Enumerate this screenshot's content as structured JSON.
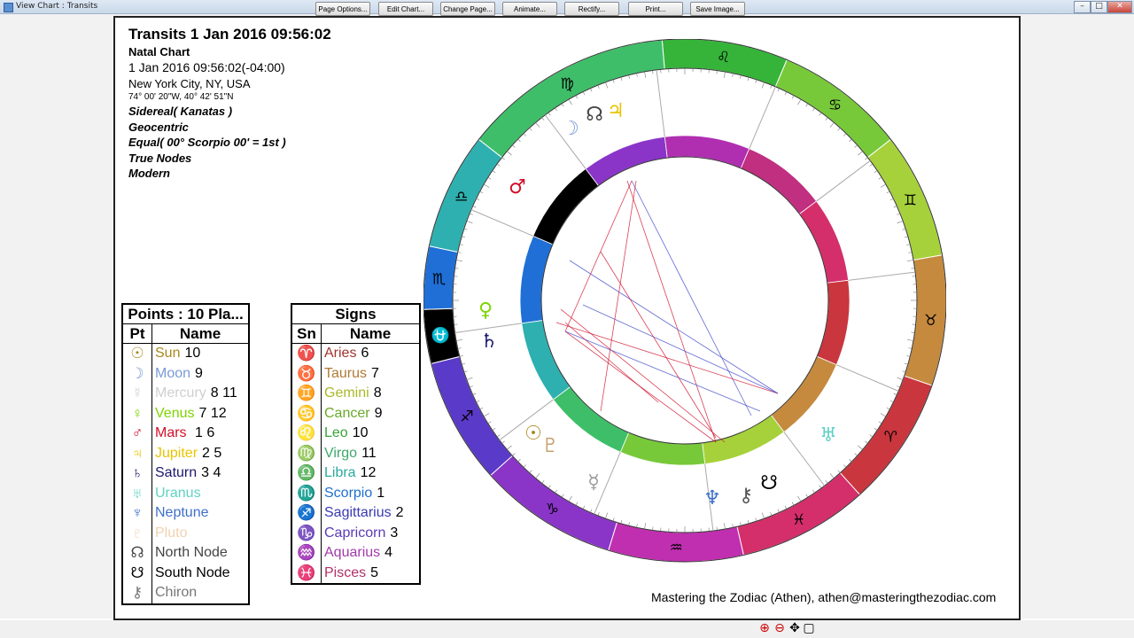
{
  "window": {
    "title": "View Chart : Transits",
    "minimize": "–",
    "maximize": "□",
    "close": "✕"
  },
  "header": {
    "title": "Transits 1 Jan 2016 09:56:02",
    "subtitle": "Natal Chart",
    "datetime": "1 Jan 2016 09:56:02(-04:00)",
    "location": "New York City, NY, USA",
    "coordinates": "74° 00' 20\"W, 40° 42' 51\"N",
    "zodiac": "Sidereal( Kanatas )",
    "centric": "Geocentric",
    "houses": "Equal( 00° Scorpio 00' = 1st )",
    "nodes": "True Nodes",
    "rulers": "Modern"
  },
  "points_table": {
    "title": "Points : 10 Pla...",
    "col_glyph": "Pt",
    "col_name": "Name",
    "rows": [
      {
        "glyph": "☉",
        "name": "Sun",
        "houses": "10",
        "color": "#a8891a"
      },
      {
        "glyph": "☽",
        "name": "Moon",
        "houses": "9",
        "color": "#7a9bd6"
      },
      {
        "glyph": "☿",
        "name": "Mercury",
        "houses": "8 11",
        "color": "#cfcfcf"
      },
      {
        "glyph": "♀",
        "name": "Venus",
        "houses": "7  12",
        "color": "#7fd400"
      },
      {
        "glyph": "♂",
        "name": "Mars",
        "houses": " 1 6",
        "color": "#d0102a"
      },
      {
        "glyph": "♃",
        "name": "Jupiter",
        "houses": "2 5",
        "color": "#e8c400"
      },
      {
        "glyph": "♄",
        "name": "Saturn",
        "houses": "3  4",
        "color": "#1a1a6e"
      },
      {
        "glyph": "♅",
        "name": "Uranus",
        "houses": "",
        "color": "#5fd1c4"
      },
      {
        "glyph": "♆",
        "name": "Neptune",
        "houses": "",
        "color": "#3f6fc9"
      },
      {
        "glyph": "♇",
        "name": "Pluto",
        "houses": "",
        "color": "#f0d2b0"
      },
      {
        "glyph": "☊",
        "name": "North Node",
        "houses": "",
        "color": "#444444"
      },
      {
        "glyph": "☋",
        "name": "South Node",
        "houses": "",
        "color": "#000000"
      },
      {
        "glyph": "⚷",
        "name": "Chiron",
        "houses": "",
        "color": "#777777"
      }
    ]
  },
  "signs_table": {
    "title": "Signs",
    "col_glyph": "Sn",
    "col_name": "Name",
    "rows": [
      {
        "glyph": "♈",
        "name": "Aries",
        "houses": "6",
        "color": "#a0332e"
      },
      {
        "glyph": "♉",
        "name": "Taurus",
        "houses": "7",
        "color": "#b07a34"
      },
      {
        "glyph": "♊",
        "name": "Gemini",
        "houses": "8",
        "color": "#a8b82a"
      },
      {
        "glyph": "♋",
        "name": "Cancer",
        "houses": "9",
        "color": "#6aa82a"
      },
      {
        "glyph": "♌",
        "name": "Leo",
        "houses": "10",
        "color": "#3aa23a"
      },
      {
        "glyph": "♍",
        "name": "Virgo",
        "houses": "11",
        "color": "#3fa86a"
      },
      {
        "glyph": "♎",
        "name": "Libra",
        "houses": "12",
        "color": "#2aa8a0"
      },
      {
        "glyph": "♏",
        "name": "Scorpio",
        "houses": "1",
        "color": "#1f6fcf"
      },
      {
        "glyph": "♐",
        "name": "Sagittarius",
        "houses": "2",
        "color": "#3a3ab0"
      },
      {
        "glyph": "♑",
        "name": "Capricorn",
        "houses": "3",
        "color": "#5a3ab8"
      },
      {
        "glyph": "♒",
        "name": "Aquarius",
        "houses": "4",
        "color": "#a03aa8"
      },
      {
        "glyph": "♓",
        "name": "Pisces",
        "houses": "5",
        "color": "#b0306a"
      }
    ]
  },
  "wheel": {
    "ascendant_sign": "Scorpio",
    "outer_sign_glyphs": [
      "♌",
      "♋",
      "♊",
      "♉",
      "♈",
      "♓",
      "♒",
      "♑",
      "♐",
      "⛎",
      "♏",
      "♎",
      "♍"
    ],
    "transit_planets": [
      {
        "glyph": "♃",
        "name": "Jupiter",
        "color": "#e8c400"
      },
      {
        "glyph": "☊",
        "name": "North Node",
        "color": "#444444"
      },
      {
        "glyph": "☽",
        "name": "Moon",
        "color": "#7a9bd6"
      },
      {
        "glyph": "♂",
        "name": "Mars",
        "color": "#d0102a"
      },
      {
        "glyph": "♀",
        "name": "Venus",
        "color": "#7fd400"
      },
      {
        "glyph": "♄",
        "name": "Saturn",
        "color": "#1a1a6e"
      },
      {
        "glyph": "☉",
        "name": "Sun",
        "color": "#a8891a"
      },
      {
        "glyph": "♇",
        "name": "Pluto",
        "color": "#c8a070"
      },
      {
        "glyph": "☿",
        "name": "Mercury",
        "color": "#999999"
      },
      {
        "glyph": "♆",
        "name": "Neptune",
        "color": "#3f6fc9"
      },
      {
        "glyph": "⚷",
        "name": "Chiron",
        "color": "#555555"
      },
      {
        "glyph": "☋",
        "name": "South Node",
        "color": "#000000"
      },
      {
        "glyph": "♅",
        "name": "Uranus",
        "color": "#5fd1c4"
      }
    ]
  },
  "footer": {
    "credit": "Mastering the Zodiac (Athen), athen@masteringthezodiac.com"
  },
  "toolbar": {
    "buttons": [
      "Page Options...",
      "Edit Chart...",
      "Change Page...",
      "Animate...",
      "Rectify...",
      "Print...",
      "Save Image..."
    ],
    "zoom_in_icon": "zoom-in-icon",
    "zoom_out_icon": "zoom-out-icon",
    "pan_icon": "pan-icon",
    "fit_icon": "fit-icon"
  }
}
